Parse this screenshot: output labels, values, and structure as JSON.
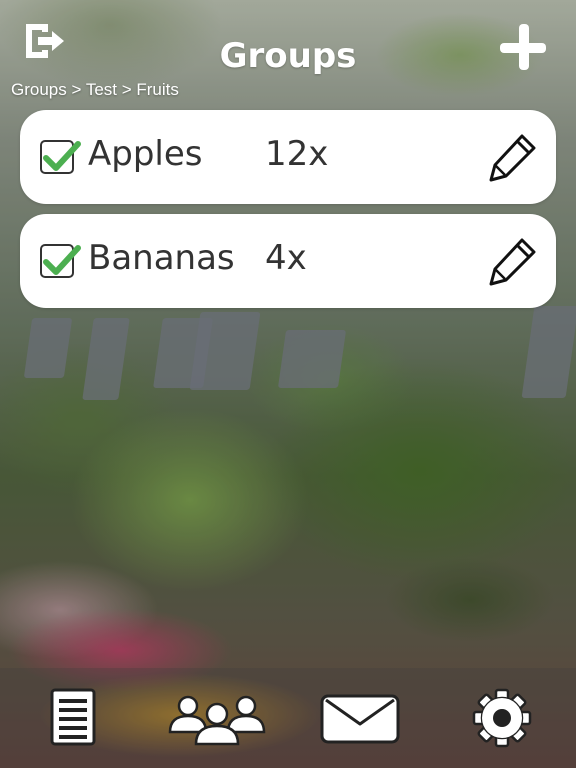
{
  "header": {
    "title": "Groups",
    "logout_icon": "logout-icon",
    "add_icon": "plus-icon"
  },
  "breadcrumb": "Groups > Test > Fruits",
  "items": [
    {
      "name": "Apples",
      "quantity": "12x",
      "checked": true
    },
    {
      "name": "Bananas",
      "quantity": "4x",
      "checked": true
    }
  ],
  "bottom_nav": {
    "items": [
      {
        "name": "list",
        "icon": "list-icon"
      },
      {
        "name": "groups",
        "icon": "people-icon"
      },
      {
        "name": "messages",
        "icon": "envelope-icon"
      },
      {
        "name": "settings",
        "icon": "gear-icon"
      }
    ]
  },
  "colors": {
    "check": "#4caf50",
    "text": "#333333",
    "card": "#ffffff"
  }
}
